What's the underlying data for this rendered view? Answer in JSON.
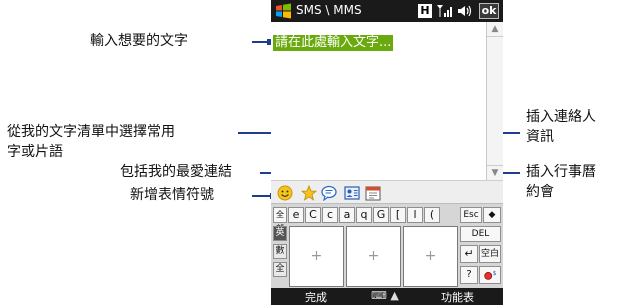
{
  "titlebar": {
    "app_title": "SMS \\ MMS",
    "h_label": "H",
    "ok_label": "ok"
  },
  "message": {
    "placeholder": "請在此處輸入文字..."
  },
  "callouts": {
    "type_text": "輸入想要的文字",
    "my_text_line1": "從我的文字清單中選擇常用",
    "my_text_line2": "字或片語",
    "favorites": "包括我的最愛連結",
    "emoticon": "新增表情符號",
    "contact_line1": "插入連絡人",
    "contact_line2": "資訊",
    "calendar_line1": "插入行事曆",
    "calendar_line2": "約會"
  },
  "icons": [
    "windows-logo-icon",
    "signal-icon",
    "volume-icon",
    "smiley-icon",
    "star-icon",
    "speech-bubble-icon",
    "contact-card-icon",
    "calendar-icon"
  ],
  "keyboard": {
    "top_row": [
      "全部",
      "e",
      "C",
      "c",
      "a",
      "q",
      "G",
      "[",
      "l",
      "("
    ],
    "side_keys": [
      "英",
      "數",
      "全"
    ],
    "hw_marks": [
      "+",
      "+",
      "+"
    ],
    "right_keys": {
      "esc": "Esc",
      "backspace": "◆",
      "del": "DEL",
      "enter": "↵",
      "space": "空白",
      "help": "?"
    }
  },
  "softkeys": {
    "left": "完成",
    "right": "功能表"
  },
  "colors": {
    "highlight": "#6aaa0f",
    "callout_line": "#1d3e8c",
    "bar": "#1a1a1a"
  }
}
